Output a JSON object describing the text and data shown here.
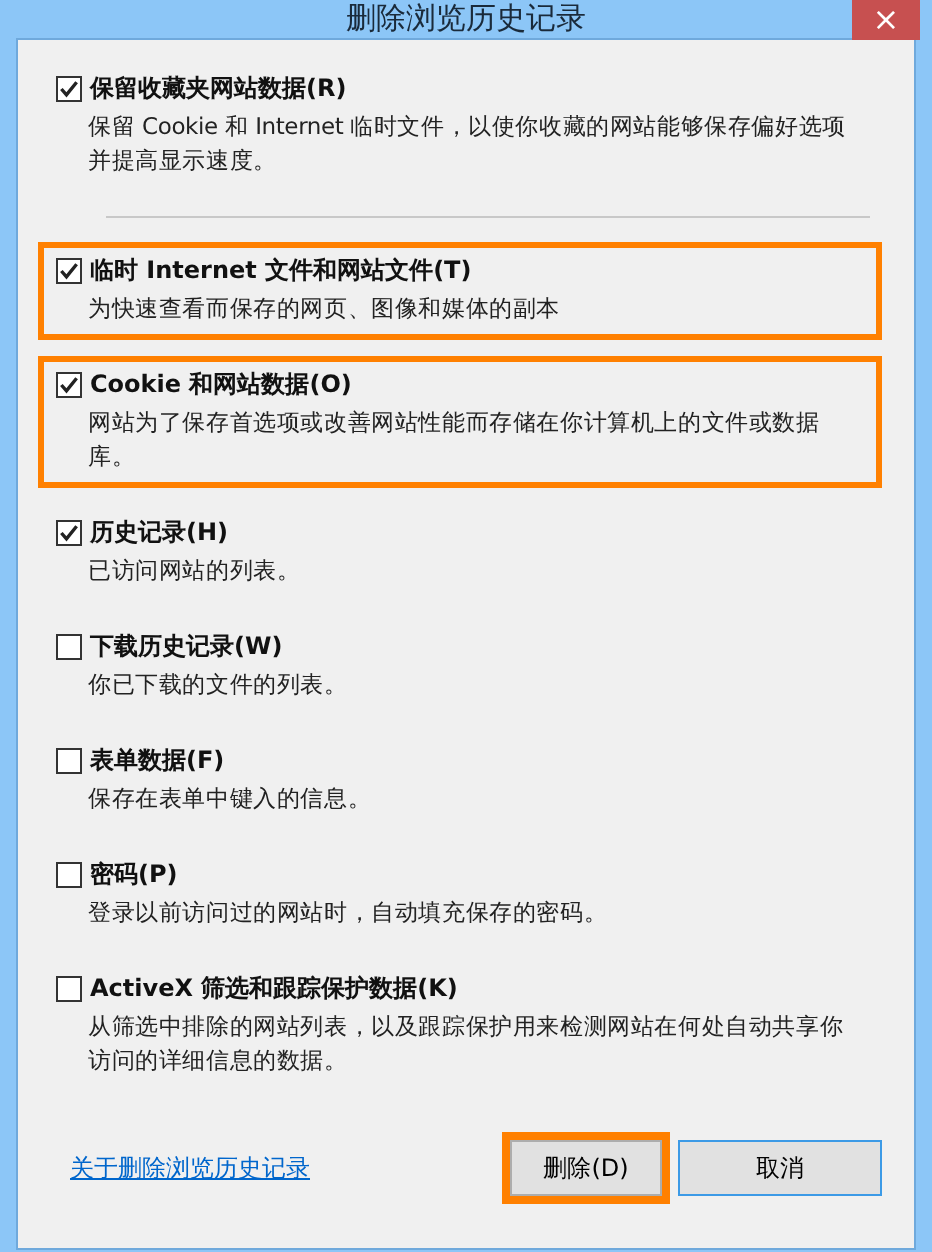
{
  "window": {
    "title": "删除浏览历史记录",
    "close": "×"
  },
  "options": [
    {
      "label": "保留收藏夹网站数据(R)",
      "description": "保留 Cookie 和 Internet 临时文件，以使你收藏的网站能够保存偏好选项并提高显示速度。",
      "checked": true,
      "highlighted": false,
      "separator_after": true
    },
    {
      "label": "临时 Internet 文件和网站文件(T)",
      "description": "为快速查看而保存的网页、图像和媒体的副本",
      "checked": true,
      "highlighted": true,
      "separator_after": false
    },
    {
      "label": "Cookie 和网站数据(O)",
      "description": "网站为了保存首选项或改善网站性能而存储在你计算机上的文件或数据库。",
      "checked": true,
      "highlighted": true,
      "separator_after": false
    },
    {
      "label": "历史记录(H)",
      "description": "已访问网站的列表。",
      "checked": true,
      "highlighted": false,
      "separator_after": false
    },
    {
      "label": "下载历史记录(W)",
      "description": "你已下载的文件的列表。",
      "checked": false,
      "highlighted": false,
      "separator_after": false
    },
    {
      "label": "表单数据(F)",
      "description": "保存在表单中键入的信息。",
      "checked": false,
      "highlighted": false,
      "separator_after": false
    },
    {
      "label": "密码(P)",
      "description": "登录以前访问过的网站时，自动填充保存的密码。",
      "checked": false,
      "highlighted": false,
      "separator_after": false
    },
    {
      "label": "ActiveX 筛选和跟踪保护数据(K)",
      "description": "从筛选中排除的网站列表，以及跟踪保护用来检测网站在何处自动共享你访问的详细信息的数据。",
      "checked": false,
      "highlighted": false,
      "separator_after": false
    }
  ],
  "link": "关于删除浏览历史记录",
  "buttons": [
    {
      "label": "删除(D)",
      "highlighted": true,
      "focused": false
    },
    {
      "label": "取消",
      "highlighted": false,
      "focused": true
    }
  ]
}
